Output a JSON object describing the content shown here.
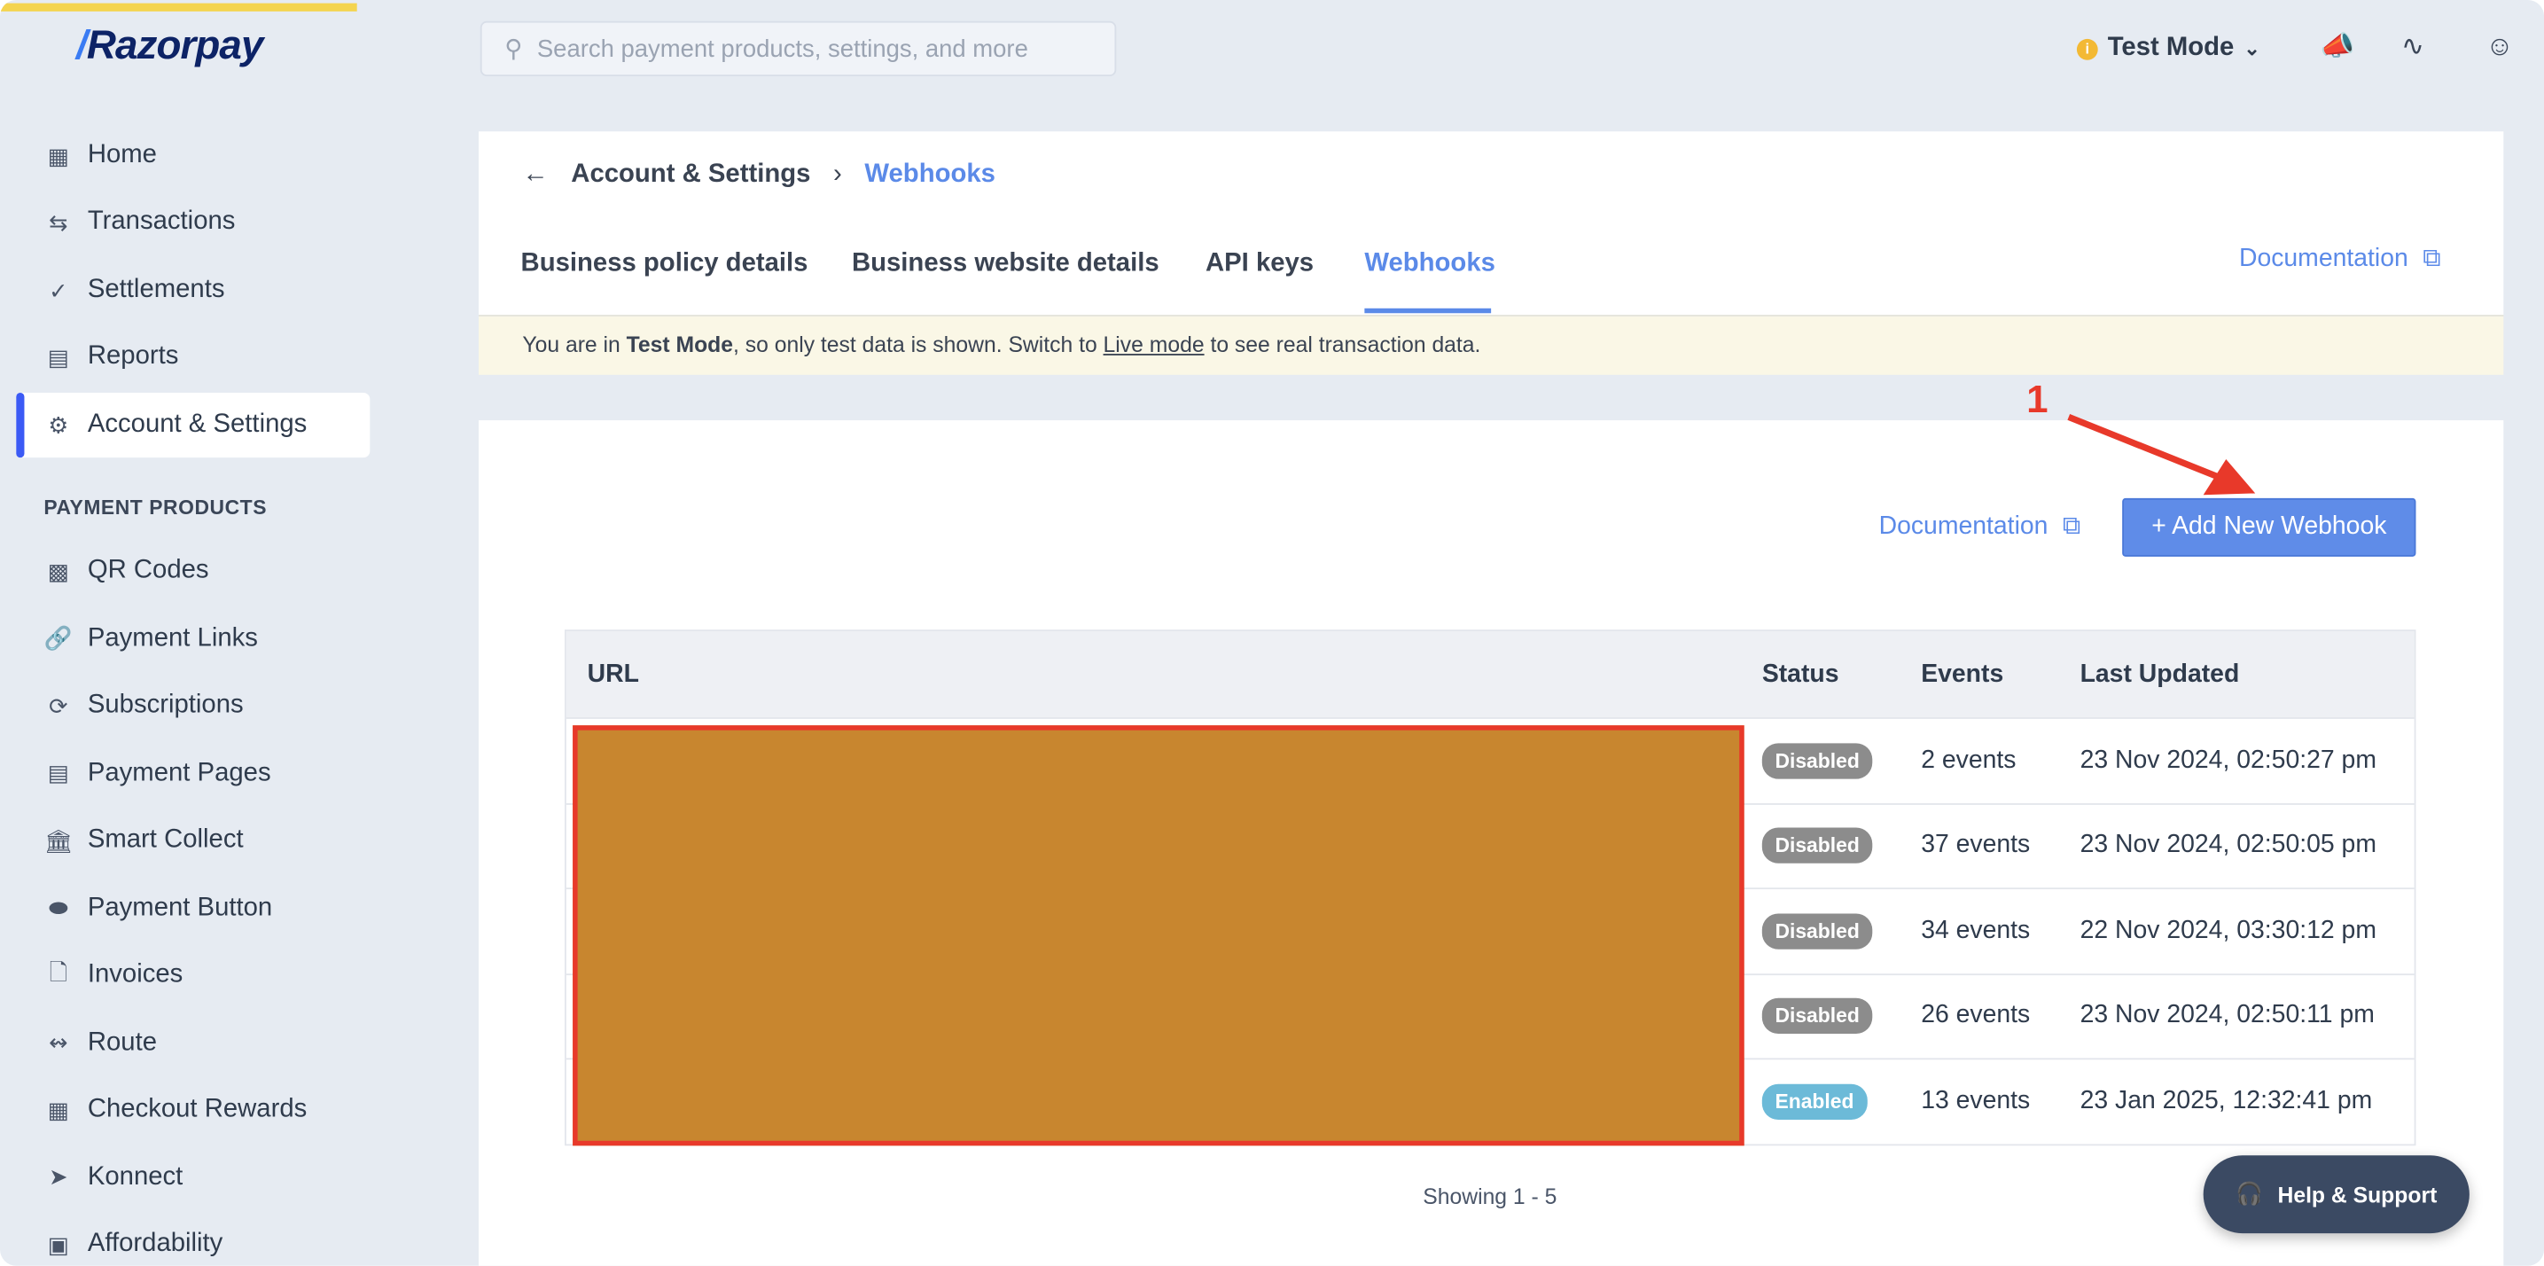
{
  "sidebar": {
    "logo": "Razorpay",
    "items": [
      {
        "label": "Home",
        "icon": "chart-icon"
      },
      {
        "label": "Transactions",
        "icon": "arrows-icon"
      },
      {
        "label": "Settlements",
        "icon": "check-icon"
      },
      {
        "label": "Reports",
        "icon": "report-icon"
      },
      {
        "label": "Account & Settings",
        "icon": "gear-icon"
      }
    ],
    "section": "PAYMENT PRODUCTS",
    "products": [
      {
        "label": "QR Codes"
      },
      {
        "label": "Payment Links"
      },
      {
        "label": "Subscriptions"
      },
      {
        "label": "Payment Pages"
      },
      {
        "label": "Smart Collect"
      },
      {
        "label": "Payment Button"
      },
      {
        "label": "Invoices"
      },
      {
        "label": "Route"
      },
      {
        "label": "Checkout Rewards"
      },
      {
        "label": "Konnect"
      },
      {
        "label": "Affordability"
      }
    ]
  },
  "header": {
    "search_placeholder": "Search payment products, settings, and more",
    "mode": "Test Mode"
  },
  "breadcrumb": {
    "parent": "Account & Settings",
    "current": "Webhooks"
  },
  "tabs": [
    "Business policy details",
    "Business website details",
    "API keys",
    "Webhooks"
  ],
  "documentation": "Documentation",
  "banner": {
    "pre": "You are in ",
    "mode": "Test Mode",
    "mid": ", so only test data is shown. Switch to ",
    "link": "Live mode",
    "post": " to see real transaction data."
  },
  "add_button": "+ Add New Webhook",
  "annotation": "1",
  "table": {
    "headers": [
      "URL",
      "Status",
      "Events",
      "Last Updated"
    ],
    "rows": [
      {
        "status": "Disabled",
        "events": "2 events",
        "updated": "23 Nov 2024, 02:50:27 pm"
      },
      {
        "status": "Disabled",
        "events": "37 events",
        "updated": "23 Nov 2024, 02:50:05 pm"
      },
      {
        "status": "Disabled",
        "events": "34 events",
        "updated": "22 Nov 2024, 03:30:12 pm"
      },
      {
        "status": "Disabled",
        "events": "26 events",
        "updated": "23 Nov 2024, 02:50:11 pm"
      },
      {
        "status": "Enabled",
        "events": "13 events",
        "updated": "23 Jan 2025, 12:32:41 pm"
      }
    ]
  },
  "showing": "Showing 1 - 5",
  "help": "Help & Support",
  "colors": {
    "accent": "#5f8ce8",
    "disabled": "#8c8c8c",
    "enabled": "#6cbad8",
    "annotation": "#e8392a"
  }
}
